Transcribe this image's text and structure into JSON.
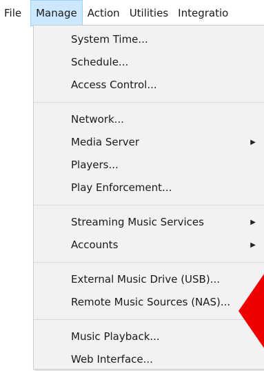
{
  "menubar": {
    "items": [
      {
        "label": "File"
      },
      {
        "label": "Manage"
      },
      {
        "label": "Action"
      },
      {
        "label": "Utilities"
      },
      {
        "label": "Integratio"
      }
    ]
  },
  "dropdown": {
    "groups": [
      [
        "System Time...",
        "Schedule...",
        "Access Control..."
      ],
      [
        "Network...",
        "Media Server",
        "Players...",
        "Play Enforcement..."
      ],
      [
        "Streaming Music Services",
        "Accounts"
      ],
      [
        "External Music Drive (USB)...",
        "Remote Music Sources (NAS)..."
      ],
      [
        "Music Playback...",
        "Web Interface..."
      ]
    ]
  },
  "colors": {
    "highlight": "#cce8ff",
    "annotation": "#ee0000"
  }
}
